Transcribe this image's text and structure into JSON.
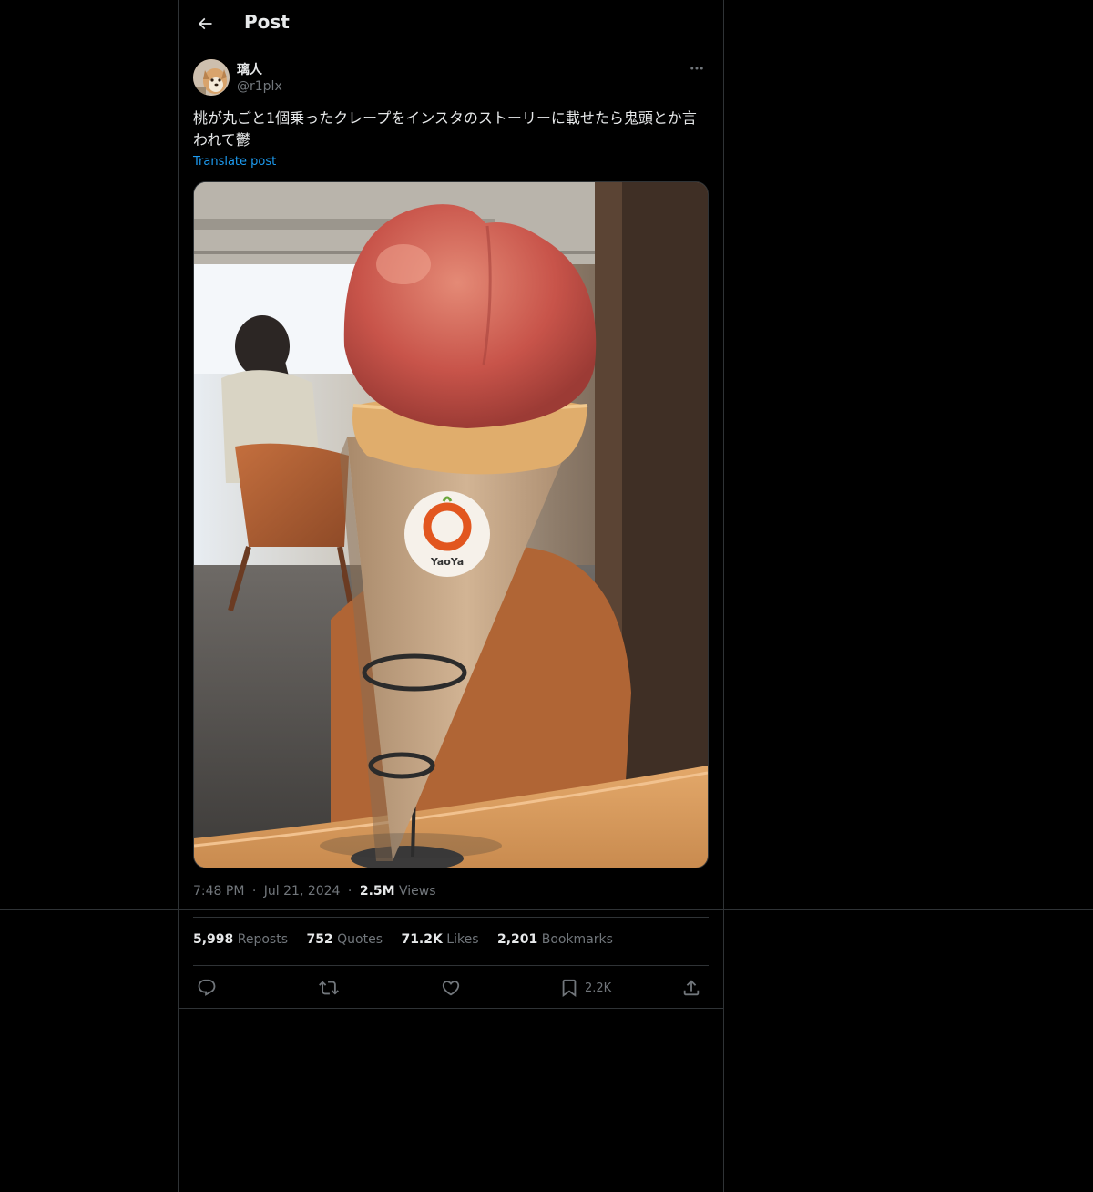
{
  "header": {
    "title": "Post",
    "back_icon": "arrow-left-icon"
  },
  "author": {
    "display_name": "璃人",
    "handle": "@r1plx"
  },
  "post": {
    "text": "桃が丸ごと1個乗ったクレープをインスタのストーリーに載せたら鬼頭とか言われて鬱",
    "translate_label": "Translate post",
    "media_label": "YaoYa"
  },
  "meta": {
    "time": "7:48 PM",
    "date": "Jul 21, 2024",
    "views_count": "2.5M",
    "views_label": "Views",
    "separator": "·"
  },
  "stats": {
    "reposts_count": "5,998",
    "reposts_label": "Reposts",
    "quotes_count": "752",
    "quotes_label": "Quotes",
    "likes_count": "71.2K",
    "likes_label": "Likes",
    "bookmarks_count": "2,201",
    "bookmarks_label": "Bookmarks"
  },
  "actions": {
    "bookmark_count": "2.2K"
  },
  "colors": {
    "background": "#000000",
    "text": "#e7e9ea",
    "muted": "#71767b",
    "border": "#2f3336",
    "link": "#1d9bf0"
  }
}
